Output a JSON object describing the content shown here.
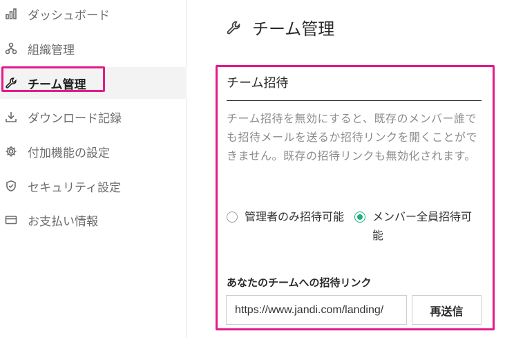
{
  "sidebar": {
    "items": [
      {
        "label": "ダッシュボード",
        "icon": "bar-chart-icon"
      },
      {
        "label": "組織管理",
        "icon": "org-chart-icon"
      },
      {
        "label": "チーム管理",
        "icon": "wrench-icon",
        "active": true
      },
      {
        "label": "ダウンロード記録",
        "icon": "download-icon"
      },
      {
        "label": "付加機能の設定",
        "icon": "gear-icon"
      },
      {
        "label": "セキュリティ設定",
        "icon": "shield-icon"
      },
      {
        "label": "お支払い情報",
        "icon": "credit-card-icon"
      }
    ]
  },
  "header": {
    "title": "チーム管理",
    "icon": "wrench-icon"
  },
  "invite": {
    "title": "チーム招待",
    "description": "チーム招待を無効にすると、既存のメンバー誰でも招待メールを送るか招待リンクを開くことができません。既存の招待リンクも無効化されます。",
    "options": [
      {
        "label": "管理者のみ招待可能",
        "selected": false
      },
      {
        "label": "メンバー全員招待可能",
        "selected": true
      }
    ],
    "link_label": "あなたのチームへの招待リンク",
    "link_value": "https://www.jandi.com/landing/",
    "resend_label": "再送信"
  },
  "colors": {
    "highlight": "#e3198a",
    "radio_selected": "#19b37a"
  }
}
